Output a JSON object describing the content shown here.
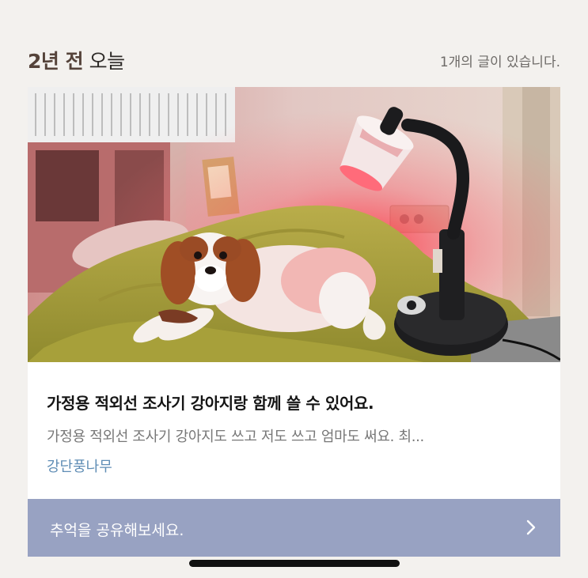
{
  "header": {
    "title_strong": "2년 전",
    "title_rest": "오늘",
    "count_text": "1개의 글이 있습니다."
  },
  "post": {
    "image_icon": "photo-dog-heat-lamp",
    "title": "가정용 적외선 조사기 강아지랑 함께 쓸 수 있어요.",
    "excerpt": "가정용 적외선 조사기 강아지도 쓰고 저도 쓰고 엄마도 써요. 최...",
    "author": "강단풍나무"
  },
  "share": {
    "label": "추억을 공유해보세요.",
    "icon": "chevron-right-icon"
  },
  "colors": {
    "background": "#f3f1ee",
    "share_bar": "#98a2c2",
    "author_link": "#5f8db5"
  }
}
